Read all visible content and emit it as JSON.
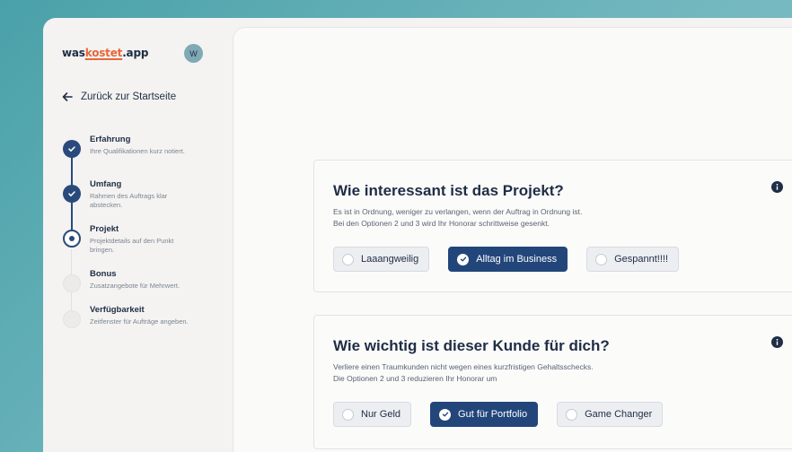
{
  "brand": {
    "prefix": "was",
    "accent": "kostet",
    "suffix": ".app"
  },
  "user": {
    "avatar_initial": "W"
  },
  "nav": {
    "back_label": "Zurück zur Startseite"
  },
  "steps": [
    {
      "title": "Erfahrung",
      "subtitle": "Ihre Qualifikationen kurz notiert.",
      "state": "done"
    },
    {
      "title": "Umfang",
      "subtitle": "Rahmen des Auftrags klar abstecken.",
      "state": "done"
    },
    {
      "title": "Projekt",
      "subtitle": "Projektdetails auf den Punkt bringen.",
      "state": "current"
    },
    {
      "title": "Bonus",
      "subtitle": "Zusatzangebote für Mehrwert.",
      "state": "todo"
    },
    {
      "title": "Verfügbarkeit",
      "subtitle": "Zeitfenster für Aufträge angeben.",
      "state": "todo"
    }
  ],
  "questions": [
    {
      "title": "Wie interessant ist das Projekt?",
      "desc_line1": "Es ist in Ordnung, weniger zu verlangen, wenn der Auftrag in Ordnung ist.",
      "desc_line2": "Bei den Optionen 2 und 3 wird Ihr Honorar schrittweise gesenkt.",
      "options": [
        "Laaangweilig",
        "Alltag im Business",
        "Gespannt!!!!"
      ],
      "selected": "Alltag im Business"
    },
    {
      "title": "Wie wichtig ist dieser Kunde für dich?",
      "desc_line1": "Verliere einen Traumkunden nicht wegen eines kurzfristigen Gehaltsschecks.",
      "desc_line2": "Die Optionen 2 und 3 reduzieren Ihr Honorar um",
      "options": [
        "Nur Geld",
        "Gut für Portfolio",
        "Game Changer"
      ],
      "selected": "Gut für Portfolio"
    }
  ],
  "colors": {
    "primary": "#22467a",
    "accent": "#e8663a",
    "text": "#1f2d45"
  }
}
